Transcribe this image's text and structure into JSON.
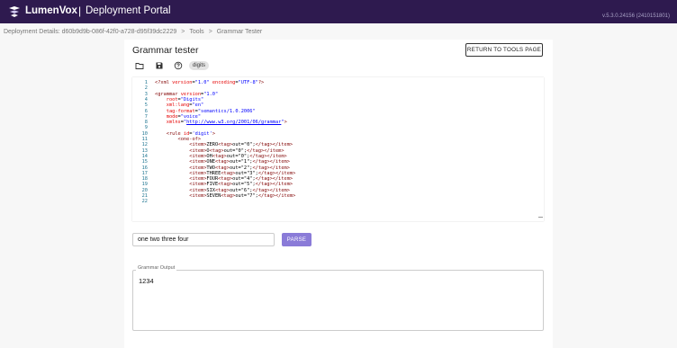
{
  "header": {
    "brand": "LumenVox",
    "separator": "|",
    "portal_title": "Deployment Portal",
    "version": "v.5.3.0.24156 (2410151801)"
  },
  "breadcrumb": {
    "items": [
      "Deployment Details: d60b9d9b-086f-42f0-a728-d95f39dc2229",
      "Tools",
      "Grammar Tester"
    ],
    "separator": ">"
  },
  "page": {
    "title": "Grammar tester",
    "return_label": "RETURN TO TOOLS PAGE",
    "chip_label": "digits"
  },
  "toolbar": {
    "icons": [
      "folder-open-icon",
      "save-icon",
      "help-circle-icon"
    ]
  },
  "editor": {
    "line_numbers": [
      "1",
      "2",
      "3",
      "4",
      "5",
      "6",
      "7",
      "8",
      "9",
      "10",
      "11",
      "12",
      "13",
      "14",
      "15",
      "16",
      "17",
      "18",
      "19",
      "20",
      "21",
      "22"
    ],
    "lines": [
      "<?xml version=\"1.0\" encoding=\"UTF-8\"?>",
      "",
      "<grammar version=\"1.0\"",
      "    root=\"Digits\"",
      "    xml:lang=\"en\"",
      "    tag-format=\"semantics/1.0.2006\"",
      "    mode=\"voice\"",
      "    xmlns=\"http://www.w3.org/2001/06/grammar\">",
      "",
      "    <rule id='digit'>",
      "        <one-of>",
      "            <item>ZERO<tag>out=\"0\";</tag></item>",
      "            <item>O<tag>out=\"0\";</tag></item>",
      "            <item>OH<tag>out=\"0\";</tag></item>",
      "            <item>ONE<tag>out=\"1\";</tag></item>",
      "            <item>TWO<tag>out=\"2\";</tag></item>",
      "            <item>THREE<tag>out=\"3\";</tag></item>",
      "            <item>FOUR<tag>out=\"4\";</tag></item>",
      "            <item>FIVE<tag>out=\"5\";</tag></item>",
      "            <item>SIX<tag>out=\"6\";</tag></item>",
      "            <item>SEVEN<tag>out=\"7\";</tag></item>",
      ""
    ]
  },
  "input": {
    "value": "one two three four",
    "parse_label": "PARSE"
  },
  "output": {
    "label": "Grammar Output",
    "value": "1234"
  },
  "colors": {
    "header_bg": "#2e1a4f",
    "parse_button": "#8a7bd8"
  }
}
